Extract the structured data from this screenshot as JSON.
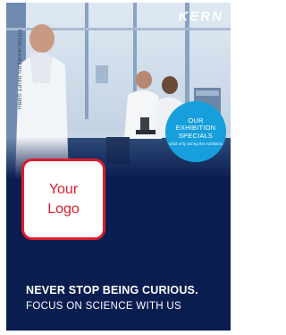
{
  "brand": "KERN",
  "vertical_text": "FOTOLIA/HKERN.DE/PT GMBH",
  "badge": {
    "lines": [
      "OUR",
      "EXHIBITION",
      "SPECIALS"
    ],
    "small_text": "Valid only during the exhibition"
  },
  "logo_box": {
    "lines": [
      "Your",
      "Logo"
    ]
  },
  "headline": "NEVER STOP BEING CURIOUS.",
  "subline": "FOCUS ON SCIENCE WITH US",
  "colors": {
    "background": "#0a1d4f",
    "badge": "#169fdc",
    "logo_border": "#dd1d2b"
  }
}
